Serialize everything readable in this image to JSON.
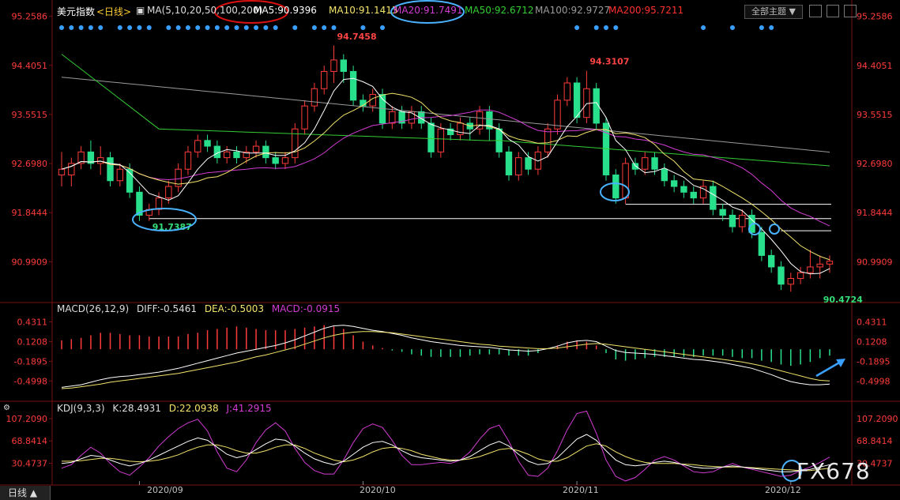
{
  "header": {
    "symbol": "美元指数",
    "period": "<日线>",
    "ma_title": "MA(5,10,20,50,100,200)",
    "ma5": "MA5:90.9396",
    "ma10": "MA10:91.1413",
    "ma20": "MA20:91.7491",
    "ma50": "MA50:92.6712",
    "ma100": "MA100:92.9727",
    "ma200": "MA200:95.7211",
    "theme_button": "全部主题"
  },
  "macd_header": {
    "title": "MACD(26,12,9)",
    "diff": "DIFF:-0.5461",
    "dea": "DEA:-0.5003",
    "macd": "MACD:-0.0915"
  },
  "kdj_header": {
    "title": "KDJ(9,3,3)",
    "k": "K:28.4931",
    "d": "D:22.0938",
    "j": "J:41.2915"
  },
  "bottom_tab": "日线",
  "watermark": "FX678",
  "colors": {
    "up": "#ff3b3b",
    "down": "#28e08c",
    "ma5": "#ffffff",
    "ma10": "#f2e36b",
    "ma20": "#d23cd2",
    "ma50": "#33cc33",
    "ma100": "#9a9a9a",
    "ma200": "#ff3030",
    "axis_label": "#ff3b3b",
    "annotation": "#4ab3ff"
  },
  "chart_data": [
    {
      "type": "candlestick",
      "title": "美元指数 日线",
      "y_ticks": [
        "95.2586",
        "94.4051",
        "93.5515",
        "92.6980",
        "91.8444",
        "90.9909"
      ],
      "ylim": [
        90.35,
        95.35
      ],
      "x_labels": [
        "2020/09",
        "2020/10",
        "2020/11",
        "2020/12"
      ],
      "x_label_index": [
        8,
        31,
        53,
        75
      ],
      "annotations": [
        {
          "label": "94.7458",
          "index": 28,
          "value": 94.7458
        },
        {
          "label": "94.3107",
          "index": 54,
          "value": 94.3107
        },
        {
          "label": "91.7387",
          "index": 9,
          "value": 91.7387
        },
        {
          "label": "90.4724",
          "index": 78,
          "value": 90.4724
        }
      ],
      "hlines": [
        91.99,
        91.74,
        91.53
      ],
      "candles": [
        [
          92.5,
          92.6,
          92.3,
          92.9
        ],
        [
          92.5,
          92.7,
          92.3,
          92.8
        ],
        [
          92.7,
          92.9,
          92.6,
          93.0
        ],
        [
          92.9,
          92.7,
          92.6,
          93.1
        ],
        [
          92.7,
          92.8,
          92.5,
          93.0
        ],
        [
          92.8,
          92.4,
          92.3,
          92.9
        ],
        [
          92.4,
          92.6,
          92.3,
          92.7
        ],
        [
          92.6,
          92.2,
          92.1,
          92.7
        ],
        [
          92.2,
          91.8,
          91.7,
          92.3
        ],
        [
          91.8,
          91.9,
          91.7,
          92.0
        ],
        [
          91.9,
          92.1,
          91.8,
          92.2
        ],
        [
          92.1,
          92.3,
          92.0,
          92.4
        ],
        [
          92.3,
          92.6,
          92.2,
          92.7
        ],
        [
          92.6,
          92.9,
          92.5,
          93.0
        ],
        [
          92.9,
          93.1,
          92.8,
          93.2
        ],
        [
          93.1,
          93.0,
          92.9,
          93.2
        ],
        [
          93.0,
          92.8,
          92.7,
          93.1
        ],
        [
          92.8,
          92.9,
          92.7,
          93.0
        ],
        [
          92.9,
          92.8,
          92.7,
          93.0
        ],
        [
          92.8,
          92.9,
          92.7,
          93.0
        ],
        [
          92.9,
          93.0,
          92.8,
          93.1
        ],
        [
          93.0,
          92.8,
          92.7,
          93.1
        ],
        [
          92.8,
          92.7,
          92.6,
          92.9
        ],
        [
          92.7,
          92.8,
          92.6,
          92.9
        ],
        [
          92.8,
          93.3,
          92.7,
          93.4
        ],
        [
          93.3,
          93.7,
          93.2,
          93.8
        ],
        [
          93.7,
          94.0,
          93.6,
          94.1
        ],
        [
          94.0,
          94.3,
          93.9,
          94.4
        ],
        [
          94.3,
          94.5,
          94.1,
          94.75
        ],
        [
          94.5,
          94.3,
          94.1,
          94.6
        ],
        [
          94.3,
          93.8,
          93.7,
          94.4
        ],
        [
          93.8,
          93.7,
          93.6,
          93.9
        ],
        [
          93.7,
          93.9,
          93.6,
          94.0
        ],
        [
          93.9,
          93.4,
          93.3,
          94.0
        ],
        [
          93.4,
          93.6,
          93.3,
          93.7
        ],
        [
          93.6,
          93.4,
          93.3,
          93.7
        ],
        [
          93.4,
          93.6,
          93.3,
          93.7
        ],
        [
          93.6,
          93.4,
          93.3,
          93.7
        ],
        [
          93.4,
          92.9,
          92.8,
          93.5
        ],
        [
          92.9,
          93.3,
          92.8,
          93.4
        ],
        [
          93.3,
          93.2,
          93.1,
          93.4
        ],
        [
          93.2,
          93.4,
          93.1,
          93.5
        ],
        [
          93.4,
          93.3,
          93.1,
          93.5
        ],
        [
          93.3,
          93.6,
          93.2,
          93.7
        ],
        [
          93.6,
          93.3,
          93.1,
          93.7
        ],
        [
          93.3,
          92.9,
          92.8,
          93.4
        ],
        [
          92.9,
          92.5,
          92.4,
          93.0
        ],
        [
          92.5,
          92.8,
          92.4,
          92.9
        ],
        [
          92.8,
          92.6,
          92.5,
          92.9
        ],
        [
          92.6,
          92.9,
          92.5,
          93.0
        ],
        [
          92.9,
          93.3,
          92.8,
          93.4
        ],
        [
          93.3,
          93.8,
          93.2,
          93.9
        ],
        [
          93.8,
          94.1,
          93.7,
          94.2
        ],
        [
          94.1,
          93.5,
          93.4,
          94.2
        ],
        [
          93.5,
          94.0,
          93.4,
          94.31
        ],
        [
          94.0,
          93.4,
          93.3,
          94.1
        ],
        [
          93.4,
          92.5,
          92.4,
          93.5
        ],
        [
          92.5,
          92.1,
          92.0,
          92.6
        ],
        [
          92.1,
          92.7,
          92.0,
          92.8
        ],
        [
          92.7,
          92.6,
          92.5,
          92.8
        ],
        [
          92.6,
          92.8,
          92.5,
          92.9
        ],
        [
          92.8,
          92.6,
          92.5,
          92.9
        ],
        [
          92.6,
          92.4,
          92.3,
          92.7
        ],
        [
          92.4,
          92.3,
          92.2,
          92.5
        ],
        [
          92.3,
          92.2,
          92.1,
          92.4
        ],
        [
          92.2,
          92.1,
          92.0,
          92.3
        ],
        [
          92.1,
          92.3,
          92.0,
          92.4
        ],
        [
          92.3,
          91.9,
          91.8,
          92.4
        ],
        [
          91.9,
          91.8,
          91.7,
          92.0
        ],
        [
          91.8,
          91.6,
          91.5,
          91.9
        ],
        [
          91.6,
          91.8,
          91.5,
          91.9
        ],
        [
          91.8,
          91.5,
          91.4,
          91.9
        ],
        [
          91.5,
          91.1,
          91.0,
          91.6
        ],
        [
          91.1,
          90.9,
          90.8,
          91.2
        ],
        [
          90.9,
          90.6,
          90.5,
          91.0
        ],
        [
          90.6,
          90.7,
          90.47,
          90.8
        ],
        [
          90.7,
          90.8,
          90.6,
          90.9
        ],
        [
          90.8,
          90.9,
          90.7,
          91.2
        ],
        [
          90.9,
          90.95,
          90.7,
          91.1
        ],
        [
          90.95,
          91.0,
          90.8,
          91.1
        ]
      ]
    },
    {
      "type": "macd",
      "y_ticks": [
        "0.4311",
        "0.1208",
        "-0.1895",
        "-0.4998"
      ],
      "ylim": [
        -0.72,
        0.55
      ],
      "diff": [
        -0.6,
        -0.58,
        -0.56,
        -0.52,
        -0.48,
        -0.45,
        -0.43,
        -0.42,
        -0.4,
        -0.38,
        -0.36,
        -0.33,
        -0.3,
        -0.26,
        -0.22,
        -0.18,
        -0.14,
        -0.1,
        -0.06,
        -0.03,
        0.0,
        0.03,
        0.06,
        0.1,
        0.15,
        0.21,
        0.27,
        0.33,
        0.37,
        0.38,
        0.36,
        0.33,
        0.3,
        0.28,
        0.25,
        0.22,
        0.18,
        0.15,
        0.12,
        0.1,
        0.08,
        0.06,
        0.05,
        0.04,
        0.03,
        0.01,
        -0.01,
        -0.02,
        -0.03,
        -0.02,
        0.01,
        0.05,
        0.1,
        0.13,
        0.14,
        0.12,
        0.05,
        -0.02,
        -0.05,
        -0.06,
        -0.07,
        -0.08,
        -0.1,
        -0.12,
        -0.14,
        -0.16,
        -0.17,
        -0.19,
        -0.21,
        -0.24,
        -0.27,
        -0.3,
        -0.35,
        -0.4,
        -0.46,
        -0.51,
        -0.54,
        -0.56,
        -0.56,
        -0.55
      ],
      "dea": [
        -0.62,
        -0.61,
        -0.59,
        -0.57,
        -0.55,
        -0.52,
        -0.5,
        -0.48,
        -0.46,
        -0.44,
        -0.42,
        -0.4,
        -0.38,
        -0.35,
        -0.32,
        -0.29,
        -0.26,
        -0.23,
        -0.2,
        -0.16,
        -0.12,
        -0.09,
        -0.05,
        -0.01,
        0.03,
        0.08,
        0.13,
        0.18,
        0.22,
        0.25,
        0.27,
        0.28,
        0.28,
        0.27,
        0.26,
        0.24,
        0.22,
        0.2,
        0.18,
        0.16,
        0.14,
        0.12,
        0.1,
        0.08,
        0.07,
        0.05,
        0.04,
        0.03,
        0.02,
        0.01,
        0.01,
        0.02,
        0.04,
        0.06,
        0.08,
        0.09,
        0.08,
        0.06,
        0.04,
        0.02,
        0.0,
        -0.02,
        -0.04,
        -0.06,
        -0.08,
        -0.1,
        -0.12,
        -0.14,
        -0.16,
        -0.18,
        -0.2,
        -0.23,
        -0.26,
        -0.3,
        -0.34,
        -0.38,
        -0.42,
        -0.46,
        -0.49,
        -0.5
      ],
      "hist": [
        0.14,
        0.16,
        0.18,
        0.22,
        0.26,
        0.26,
        0.24,
        0.22,
        0.22,
        0.2,
        0.2,
        0.2,
        0.2,
        0.24,
        0.26,
        0.3,
        0.32,
        0.34,
        0.36,
        0.34,
        0.32,
        0.3,
        0.3,
        0.3,
        0.32,
        0.34,
        0.36,
        0.38,
        0.36,
        0.32,
        0.22,
        0.12,
        0.06,
        0.02,
        -0.02,
        -0.04,
        -0.08,
        -0.1,
        -0.12,
        -0.12,
        -0.12,
        -0.12,
        -0.1,
        -0.08,
        -0.08,
        -0.08,
        -0.1,
        -0.1,
        -0.1,
        -0.06,
        0.0,
        0.06,
        0.12,
        0.14,
        0.12,
        0.06,
        -0.06,
        -0.16,
        -0.18,
        -0.16,
        -0.14,
        -0.12,
        -0.12,
        -0.12,
        -0.12,
        -0.12,
        -0.1,
        -0.1,
        -0.1,
        -0.12,
        -0.14,
        -0.14,
        -0.18,
        -0.2,
        -0.24,
        -0.26,
        -0.24,
        -0.2,
        -0.14,
        -0.1
      ]
    },
    {
      "type": "kdj",
      "y_ticks": [
        "107.2090",
        "68.8414",
        "30.4737"
      ],
      "ylim": [
        4,
        118
      ],
      "k": [
        30,
        32,
        38,
        44,
        42,
        36,
        30,
        26,
        30,
        36,
        44,
        52,
        60,
        68,
        74,
        70,
        58,
        46,
        40,
        44,
        54,
        64,
        72,
        70,
        60,
        48,
        38,
        32,
        28,
        34,
        46,
        58,
        66,
        68,
        62,
        52,
        44,
        40,
        38,
        36,
        34,
        36,
        42,
        52,
        62,
        68,
        60,
        46,
        34,
        28,
        30,
        40,
        56,
        72,
        80,
        70,
        52,
        36,
        28,
        26,
        28,
        32,
        34,
        32,
        28,
        24,
        22,
        22,
        24,
        26,
        24,
        22,
        20,
        18,
        16,
        16,
        18,
        20,
        24,
        28
      ],
      "d": [
        34,
        34,
        35,
        37,
        39,
        39,
        37,
        34,
        33,
        34,
        36,
        40,
        45,
        52,
        58,
        62,
        62,
        58,
        52,
        48,
        48,
        52,
        58,
        62,
        62,
        56,
        48,
        42,
        36,
        33,
        36,
        42,
        50,
        56,
        58,
        56,
        52,
        46,
        42,
        38,
        36,
        36,
        38,
        42,
        48,
        54,
        56,
        52,
        46,
        38,
        34,
        34,
        40,
        50,
        60,
        64,
        60,
        50,
        42,
        36,
        32,
        30,
        30,
        30,
        29,
        28,
        26,
        25,
        24,
        24,
        24,
        23,
        22,
        21,
        20,
        19,
        18,
        18,
        20,
        22
      ],
      "j": [
        22,
        28,
        44,
        58,
        48,
        30,
        16,
        10,
        24,
        40,
        60,
        76,
        90,
        100,
        106,
        86,
        50,
        22,
        16,
        36,
        66,
        88,
        100,
        86,
        56,
        32,
        18,
        12,
        12,
        36,
        66,
        90,
        98,
        92,
        70,
        44,
        28,
        28,
        30,
        32,
        30,
        36,
        50,
        72,
        90,
        96,
        68,
        34,
        10,
        8,
        22,
        52,
        88,
        116,
        120,
        82,
        36,
        8,
        0,
        6,
        20,
        36,
        42,
        36,
        26,
        16,
        14,
        16,
        24,
        30,
        24,
        20,
        16,
        12,
        8,
        10,
        18,
        24,
        32,
        41
      ]
    }
  ]
}
